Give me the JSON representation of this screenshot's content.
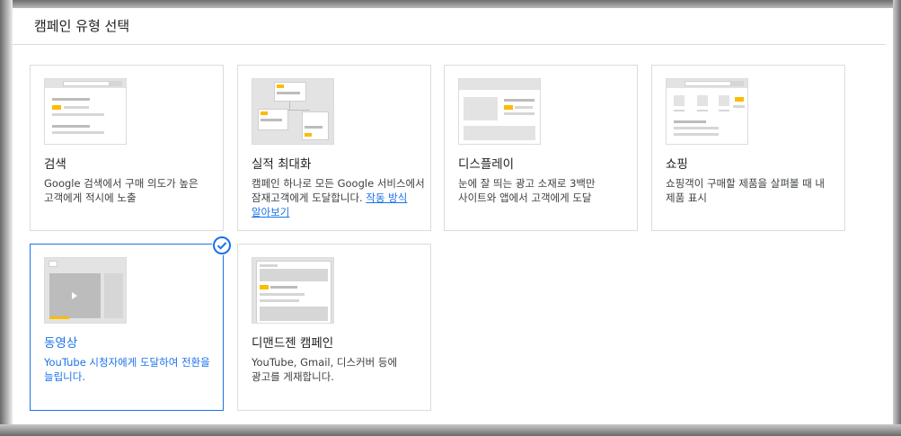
{
  "header": {
    "title": "캠페인 유형 선택"
  },
  "cards": {
    "search": {
      "title": "검색",
      "desc": "Google 검색에서 구매 의도가 높은 고객에게 적시에 노출"
    },
    "pmax": {
      "title": "실적 최대화",
      "desc": "캠페인 하나로 모든 Google 서비스에서 잠재고객에게 도달합니다. ",
      "link": "작동 방식 알아보기"
    },
    "display": {
      "title": "디스플레이",
      "desc": "눈에 잘 띄는 광고 소재로 3백만 사이트와 앱에서 고객에게 도달"
    },
    "shopping": {
      "title": "쇼핑",
      "desc": "쇼핑객이 구매할 제품을 살펴볼 때 내 제품 표시"
    },
    "video": {
      "title": "동영상",
      "desc": "YouTube 시청자에게 도달하여 전환을 늘립니다.",
      "selected": true
    },
    "demandgen": {
      "title": "디맨드젠 캠페인",
      "desc": "YouTube, Gmail, 디스커버 등에 광고를 게재합니다."
    }
  },
  "colors": {
    "accent": "#1a73e8",
    "highlight": "#fbbc04",
    "border": "#dadce0",
    "text": "#202124"
  },
  "icons": {
    "selected": "check-circle-icon"
  }
}
